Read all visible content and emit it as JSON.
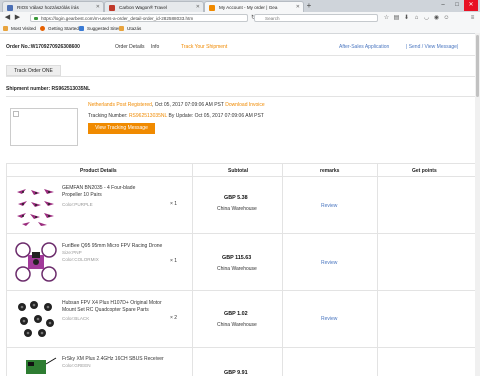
{
  "browser": {
    "tabs": [
      {
        "title": "RIOS Válasz hozzászólás írás",
        "active": false
      },
      {
        "title": "Carbon Wagon® Travel",
        "active": false
      },
      {
        "title": "My Account - My order | Gea",
        "active": true
      }
    ],
    "url": "https://login.gearbest.com/m-users-a-order_detail-order_id-282588033.htm",
    "search_placeholder": "Search",
    "bookmarks": [
      "Most Visited",
      "Getting Started",
      "Suggested Sites",
      "Utazás"
    ]
  },
  "order": {
    "number_label": "Order No.:W1709270926308600",
    "tabs": [
      "Order Details",
      "Info",
      "Track Your Shipment"
    ],
    "after_sales": "After-Sales Application",
    "send_view": "| Send / View Message|",
    "track_tab": "Track Order ONE",
    "shipment_number_label": "Shipment number: RS962513035NL",
    "carrier": "Netherlands Post Registered",
    "carrier_date": ", Oct 05, 2017 07:09:06 AM PST",
    "download_invoice": "Download Invoice",
    "tracking_prefix": "Tracking Number: ",
    "tracking_number": "RS962513035NL",
    "update_text": " By Update: Oct 05, 2017 07:09:06 AM PST",
    "view_tracking": "View Tracking Message"
  },
  "table": {
    "headers": [
      "Product Details",
      "Subtotal",
      "remarks",
      "Get points"
    ],
    "rows": [
      {
        "name": "GEMFAN BN2035 - 4 Four-blade Propeller 10 Pairs",
        "color": "Color:PURPLE",
        "qty": "× 1",
        "price": "GBP 5.38",
        "warehouse": "China Warehouse",
        "review": "Review"
      },
      {
        "name": "FuriBee Q95 95mm Micro FPV Racing Drone",
        "color": "Size:PNP",
        "color2": "Color:COLORMIX",
        "qty": "× 1",
        "price": "GBP 115.63",
        "warehouse": "China Warehouse",
        "review": "Review"
      },
      {
        "name": "Hubsan FPV X4 Plus H107D+ Original Motor Mount Set RC Quadcopter Spare Parts",
        "color": "Color:BLACK",
        "qty": "× 2",
        "price": "GBP 1.02",
        "warehouse": "China Warehouse",
        "review": "Review"
      },
      {
        "name": "FrSky XM Plus 2.4GHz 16CH SBUS Receiver",
        "color": "Color:GREEN",
        "qty": "",
        "price": "GBP 9.91",
        "warehouse": "",
        "review": ""
      }
    ]
  },
  "colors": {
    "accent": "#f08a00",
    "link": "#4a76c0"
  }
}
